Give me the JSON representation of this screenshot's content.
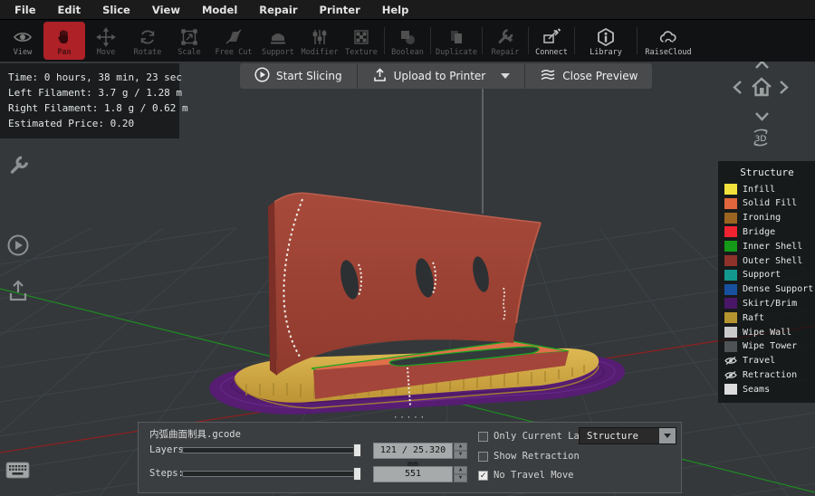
{
  "menubar": {
    "items": [
      "File",
      "Edit",
      "Slice",
      "View",
      "Model",
      "Repair",
      "Printer",
      "Help"
    ]
  },
  "toolbar": {
    "active_item": "Pan",
    "active_color": "#ad2127",
    "items": [
      {
        "label": "View"
      },
      {
        "label": "Pan"
      },
      {
        "label": "Move"
      },
      {
        "label": "Rotate"
      },
      {
        "label": "Scale"
      },
      {
        "label": "Free Cut"
      },
      {
        "label": "Support"
      },
      {
        "label": "Modifier"
      },
      {
        "label": "Texture"
      },
      {
        "label": "Boolean"
      },
      {
        "label": "Duplicate"
      },
      {
        "label": "Repair"
      },
      {
        "label": "Connect"
      },
      {
        "label": "Library"
      },
      {
        "label": "RaiseCloud"
      }
    ]
  },
  "stats": {
    "time": "Time: 0 hours, 38 min, 23 sec",
    "left_filament": "Left Filament: 3.7 g / 1.28 m",
    "right_filament": "Right Filament: 1.8 g / 0.62 m",
    "estimated_price": "Estimated Price: 0.20"
  },
  "action_bar": {
    "start_slicing": "Start Slicing",
    "upload_to_printer": "Upload to Printer",
    "close_preview": "Close Preview"
  },
  "nav": {
    "rotate_3d_label": "3D"
  },
  "legend": {
    "title": "Structure",
    "items": [
      {
        "label": "Infill",
        "icon": "swatch",
        "color": "#f2e13c"
      },
      {
        "label": "Solid Fill",
        "icon": "swatch",
        "color": "#e2663d"
      },
      {
        "label": "Ironing",
        "icon": "swatch",
        "color": "#9a6420"
      },
      {
        "label": "Bridge",
        "icon": "swatch",
        "color": "#f22330"
      },
      {
        "label": "Inner Shell",
        "icon": "swatch",
        "color": "#149a18"
      },
      {
        "label": "Outer Shell",
        "icon": "swatch",
        "color": "#8e322a"
      },
      {
        "label": "Support",
        "icon": "swatch",
        "color": "#13988e"
      },
      {
        "label": "Dense Support",
        "icon": "swatch",
        "color": "#17509e"
      },
      {
        "label": "Skirt/Brim",
        "icon": "swatch",
        "color": "#4a1668"
      },
      {
        "label": "Raft",
        "icon": "swatch",
        "color": "#b3942f"
      },
      {
        "label": "Wipe Wall",
        "icon": "swatch",
        "color": "#c9c9c9"
      },
      {
        "label": "Wipe Tower",
        "icon": "swatch",
        "color": "#4e5254"
      },
      {
        "label": "Travel",
        "icon": "eye-off"
      },
      {
        "label": "Retraction",
        "icon": "eye-off"
      },
      {
        "label": "Seams",
        "icon": "swatch",
        "color": "#dcdcdc"
      }
    ]
  },
  "bottom_panel": {
    "drag_handle": "·····",
    "filename": "内弧曲面制具.gcode",
    "layers_label": "Layers:",
    "layers_value": "121 / 25.320 mm",
    "steps_label": "Steps:",
    "steps_value": "551",
    "spin_up": "▲",
    "spin_down": "▼",
    "check_glyph": "✓",
    "checkboxes": [
      {
        "label": "Only Current Layer",
        "checked": false
      },
      {
        "label": "Show Retraction",
        "checked": false
      },
      {
        "label": "No Travel Move",
        "checked": true
      }
    ],
    "view_mode_dropdown": {
      "value": "Structure"
    }
  },
  "viewport": {
    "axis_x_color": "#8b2020",
    "axis_y_color": "#1e8a22",
    "model_wall_color": "#9d4336",
    "raft_color": "#d4ad46",
    "skirt_color": "#561d73",
    "solid_fill_top_color": "#df7049"
  }
}
